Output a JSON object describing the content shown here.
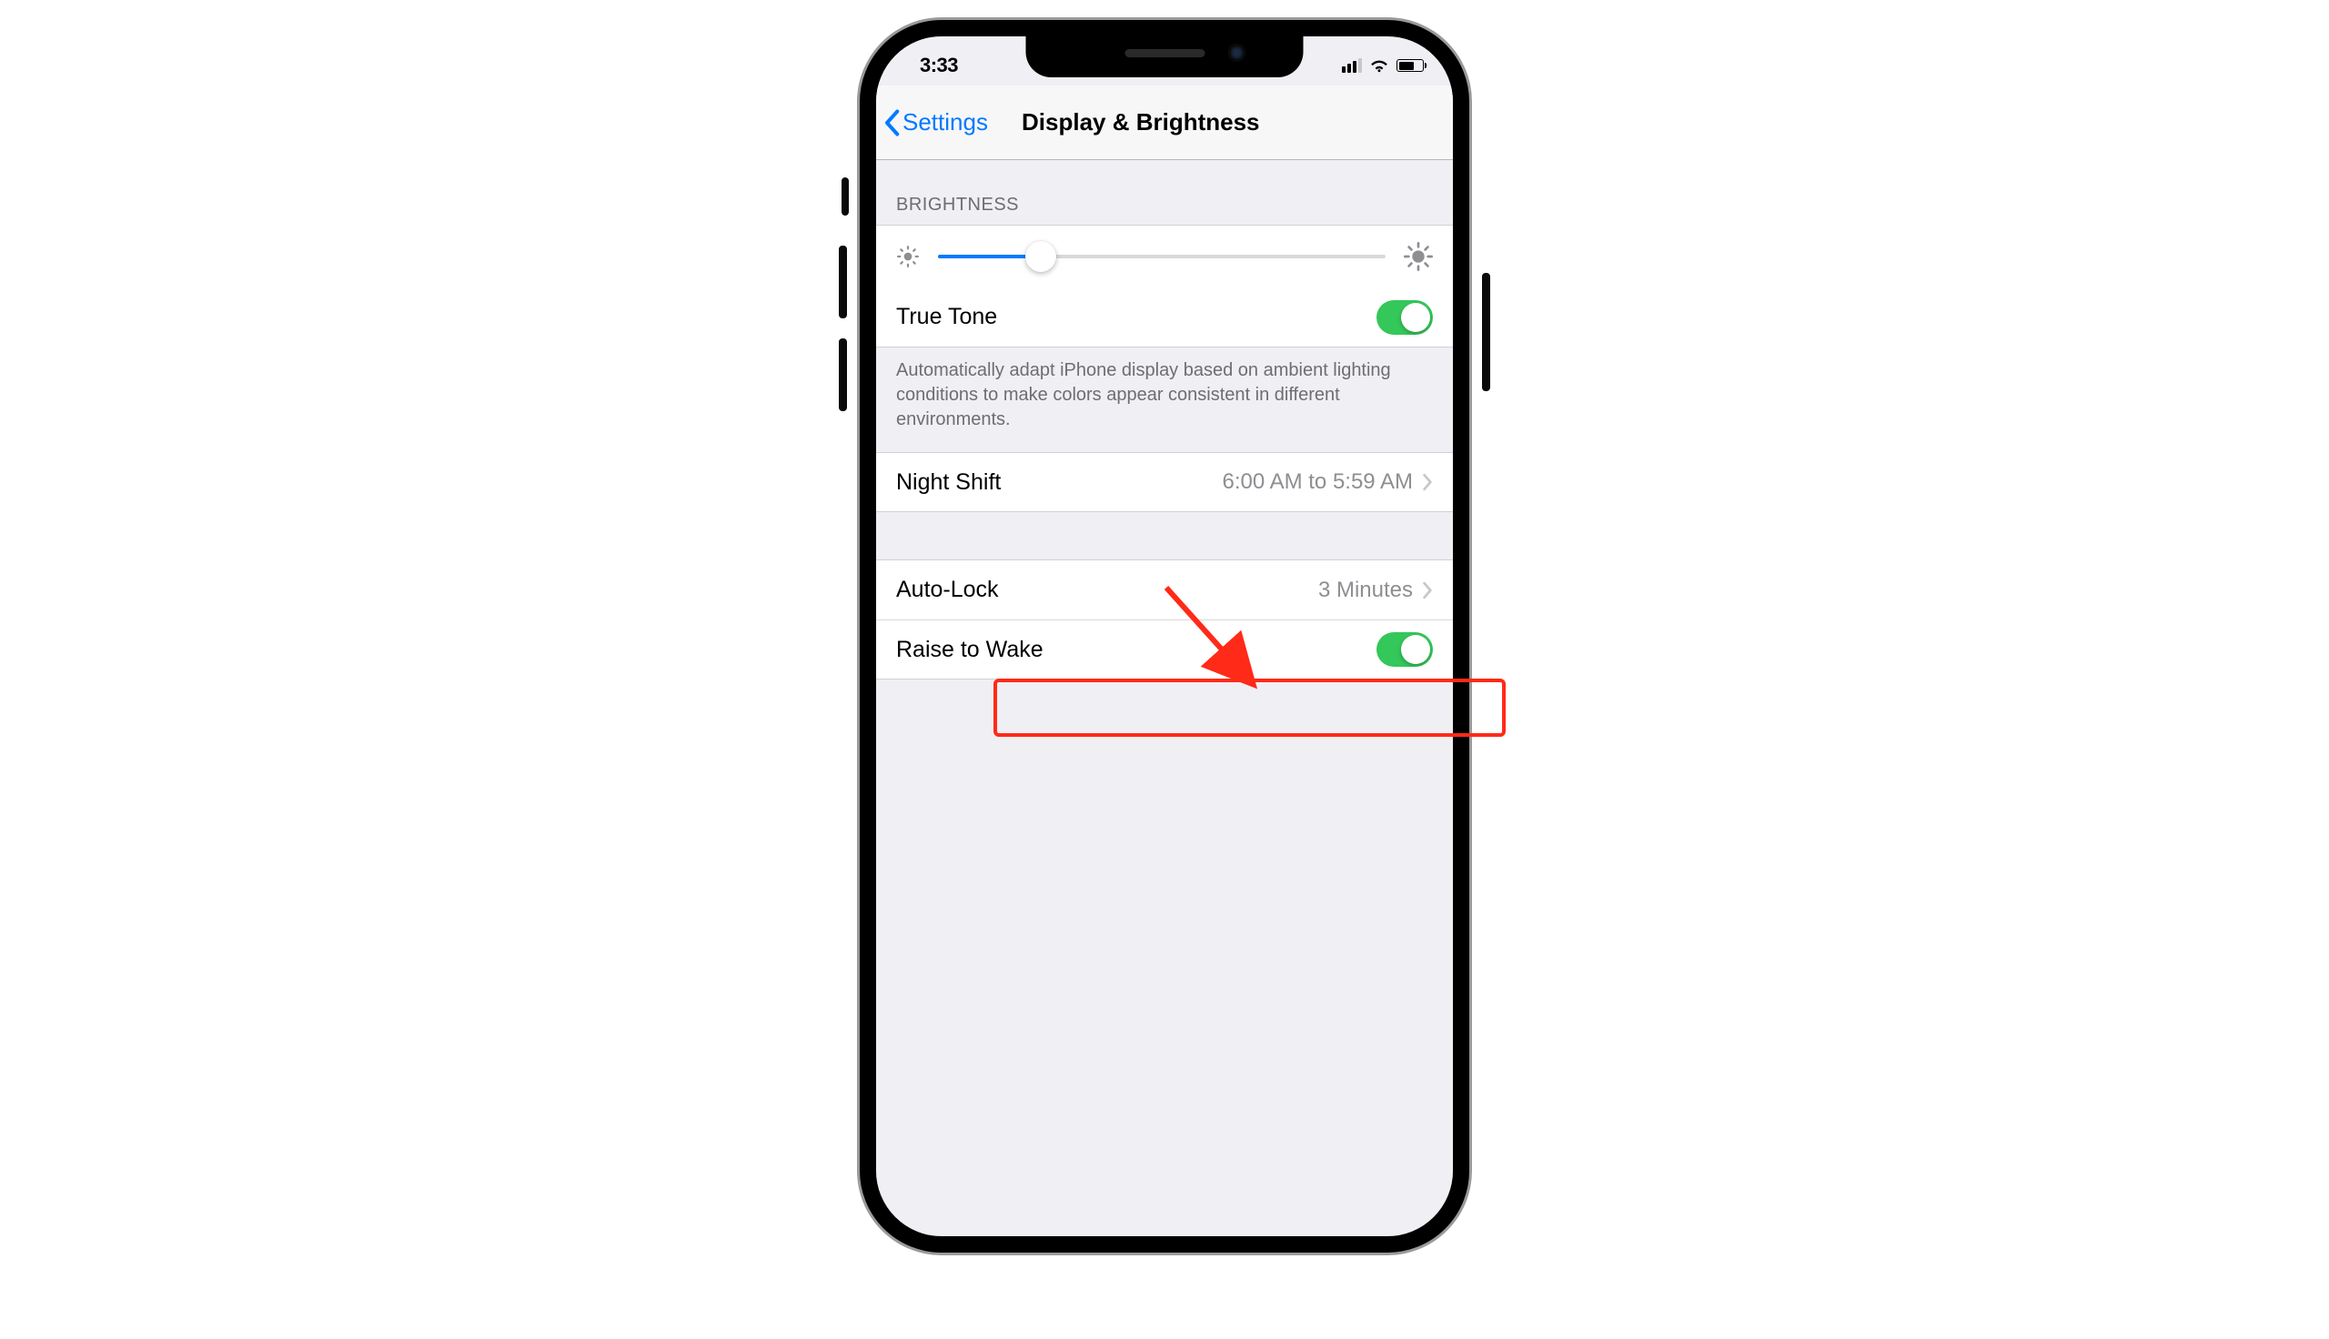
{
  "status": {
    "time": "3:33"
  },
  "nav": {
    "back_label": "Settings",
    "title": "Display & Brightness"
  },
  "brightness": {
    "header": "BRIGHTNESS",
    "slider_percent": 23
  },
  "true_tone": {
    "label": "True Tone",
    "on": true,
    "note": "Automatically adapt iPhone display based on ambient lighting conditions to make colors appear consistent in different environments."
  },
  "night_shift": {
    "label": "Night Shift",
    "value": "6:00 AM to 5:59 AM"
  },
  "auto_lock": {
    "label": "Auto-Lock",
    "value": "3 Minutes"
  },
  "raise_to_wake": {
    "label": "Raise to Wake",
    "on": true
  }
}
